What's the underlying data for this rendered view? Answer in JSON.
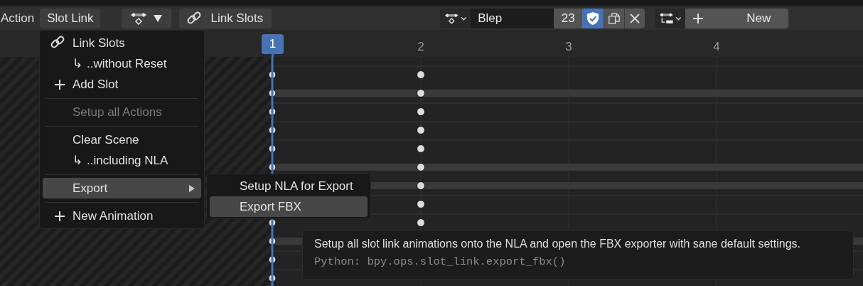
{
  "header": {
    "editor_label": "Action",
    "menu_button": {
      "label": "Slot Link",
      "open": true
    },
    "link_button": "Link Slots",
    "action_field": {
      "value": "Blep",
      "users": "23",
      "fake_user": true
    },
    "new_button": "New"
  },
  "ruler": {
    "frames": [
      {
        "label": "1",
        "current": true
      },
      {
        "label": "2",
        "current": false
      },
      {
        "label": "3",
        "current": false
      },
      {
        "label": "4",
        "current": false
      }
    ]
  },
  "rows": [
    {
      "summary": false
    },
    {
      "summary": true
    },
    {
      "summary": false
    },
    {
      "summary": false
    },
    {
      "summary": false
    },
    {
      "summary": true
    },
    {
      "summary": true
    },
    {
      "summary": false
    },
    {
      "summary": false
    },
    {
      "summary": true
    },
    {
      "summary": false
    },
    {
      "summary": false
    }
  ],
  "menu": {
    "items": [
      {
        "kind": "link",
        "label": "Link Slots",
        "disabled": false,
        "highlighted": false
      },
      {
        "kind": "sub",
        "prefix": "↳",
        "label": "..without Reset",
        "disabled": false,
        "highlighted": false
      },
      {
        "kind": "add",
        "label": "Add Slot",
        "disabled": false,
        "highlighted": false
      },
      {
        "kind": "separator"
      },
      {
        "kind": "plain",
        "label": "Setup all Actions",
        "disabled": true,
        "highlighted": false
      },
      {
        "kind": "separator"
      },
      {
        "kind": "plain",
        "label": "Clear Scene",
        "disabled": false,
        "highlighted": false
      },
      {
        "kind": "sub",
        "prefix": "↳",
        "label": "..including NLA",
        "disabled": false,
        "highlighted": false
      },
      {
        "kind": "separator"
      },
      {
        "kind": "submenu",
        "label": "Export",
        "disabled": false,
        "highlighted": true
      },
      {
        "kind": "separator"
      },
      {
        "kind": "add",
        "label": "New Animation",
        "disabled": false,
        "highlighted": false
      }
    ]
  },
  "submenu": {
    "items": [
      {
        "label": "Setup NLA for Export",
        "highlighted": false
      },
      {
        "label": "Export FBX",
        "highlighted": true
      }
    ]
  },
  "tooltip": {
    "description": "Setup all slot link animations onto the NLA and open the FBX exporter with sane default settings.",
    "python": "Python: bpy.ops.slot_link.export_fbx()"
  }
}
